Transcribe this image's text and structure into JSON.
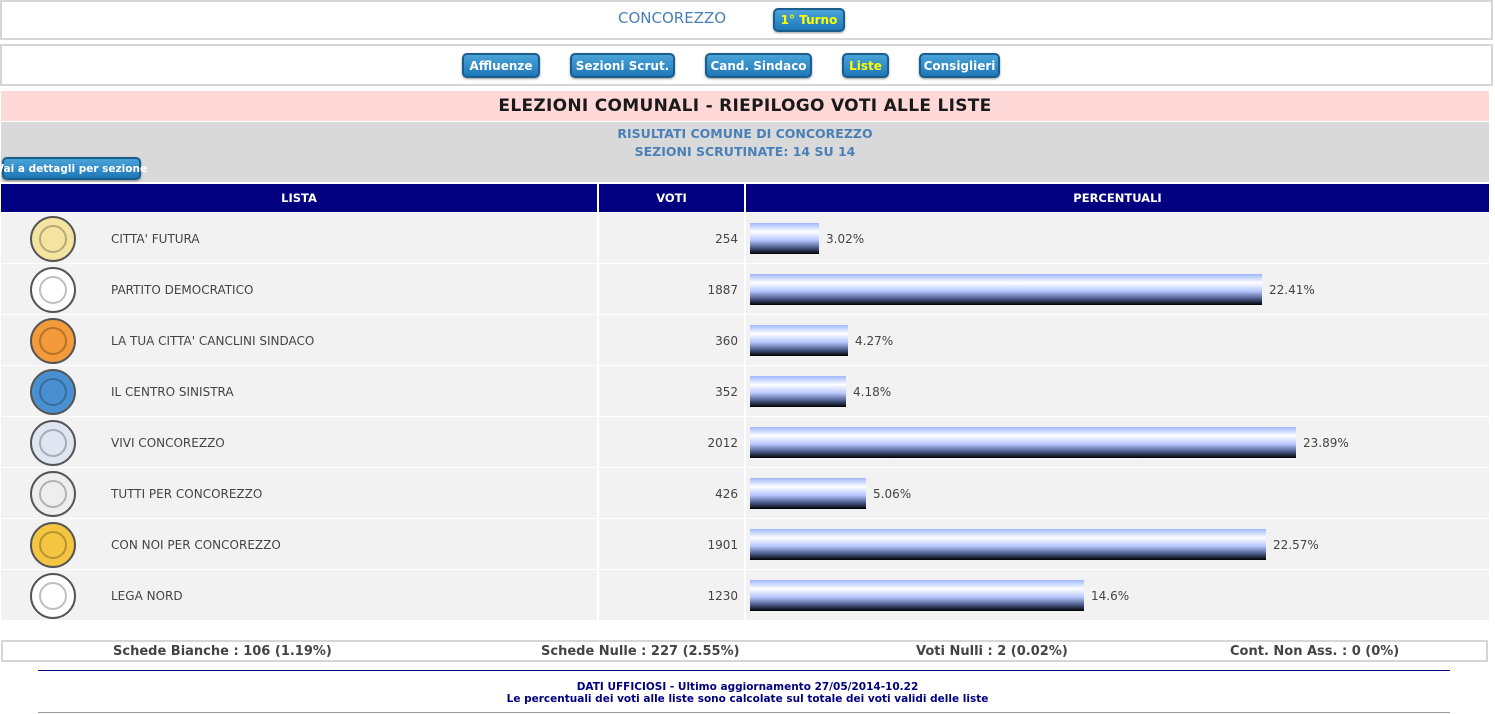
{
  "header": {
    "town": "CONCOREZZO",
    "round_button": "1° Turno"
  },
  "nav": {
    "items": [
      {
        "label": "Affluenze",
        "active": false
      },
      {
        "label": "Sezioni Scrut.",
        "active": false
      },
      {
        "label": "Cand. Sindaco",
        "active": false
      },
      {
        "label": "Liste",
        "active": true
      },
      {
        "label": "Consiglieri",
        "active": false
      }
    ]
  },
  "title": "ELEZIONI COMUNALI - RIEPILOGO VOTI ALLE LISTE",
  "info": {
    "line1": "RISULTATI COMUNE DI CONCOREZZO",
    "line2": "SEZIONI SCRUTINATE: 14 SU 14",
    "details_button": "Vai a dettagli per sezione"
  },
  "table": {
    "headers": {
      "list": "LISTA",
      "votes": "VOTI",
      "percent": "PERCENTUALI"
    },
    "rows": [
      {
        "name": "CITTA' FUTURA",
        "votes": "254",
        "percent_label": "3.02%",
        "percent": 3.02,
        "logo_color": "#f5e3a0",
        "logo_icon": "citta-futura-logo-icon"
      },
      {
        "name": "PARTITO DEMOCRATICO",
        "votes": "1887",
        "percent_label": "22.41%",
        "percent": 22.41,
        "logo_color": "#ffffff",
        "logo_icon": "pd-logo-icon"
      },
      {
        "name": "LA TUA CITTA' CANCLINI SINDACO",
        "votes": "360",
        "percent_label": "4.27%",
        "percent": 4.27,
        "logo_color": "#f39a3a",
        "logo_icon": "la-tua-citta-logo-icon"
      },
      {
        "name": "IL CENTRO SINISTRA",
        "votes": "352",
        "percent_label": "4.18%",
        "percent": 4.18,
        "logo_color": "#4a90d0",
        "logo_icon": "centro-sinistra-logo-icon"
      },
      {
        "name": "VIVI CONCOREZZO",
        "votes": "2012",
        "percent_label": "23.89%",
        "percent": 23.89,
        "logo_color": "#dfe6f2",
        "logo_icon": "vivi-concorezzo-logo-icon"
      },
      {
        "name": "TUTTI PER CONCOREZZO",
        "votes": "426",
        "percent_label": "5.06%",
        "percent": 5.06,
        "logo_color": "#eeeeee",
        "logo_icon": "tutti-per-concorezzo-logo-icon"
      },
      {
        "name": "CON NOI PER CONCOREZZO",
        "votes": "1901",
        "percent_label": "22.57%",
        "percent": 22.57,
        "logo_color": "#f5c542",
        "logo_icon": "con-noi-logo-icon"
      },
      {
        "name": "LEGA NORD",
        "votes": "1230",
        "percent_label": "14.6%",
        "percent": 14.6,
        "logo_color": "#ffffff",
        "logo_icon": "lega-nord-logo-icon"
      }
    ]
  },
  "stats": {
    "bianche": "Schede Bianche : 106 (1.19%)",
    "nulle": "Schede Nulle : 227 (2.55%)",
    "voti_nulli": "Voti Nulli : 2 (0.02%)",
    "contestate": "Cont. Non Ass. : 0 (0%)"
  },
  "footer": {
    "line1": "DATI UFFICIOSI - Ultimo aggiornamento 27/05/2014-10.22",
    "line2": "Le percentuali dei voti alle liste sono calcolate sul totale dei voti validi delle liste"
  },
  "colors": {
    "header_bg": "#000080",
    "title_bg": "#ffd8d8",
    "info_bg": "#d9d9d9",
    "button": "#2a85c4",
    "active_button_text": "#ffff00"
  }
}
